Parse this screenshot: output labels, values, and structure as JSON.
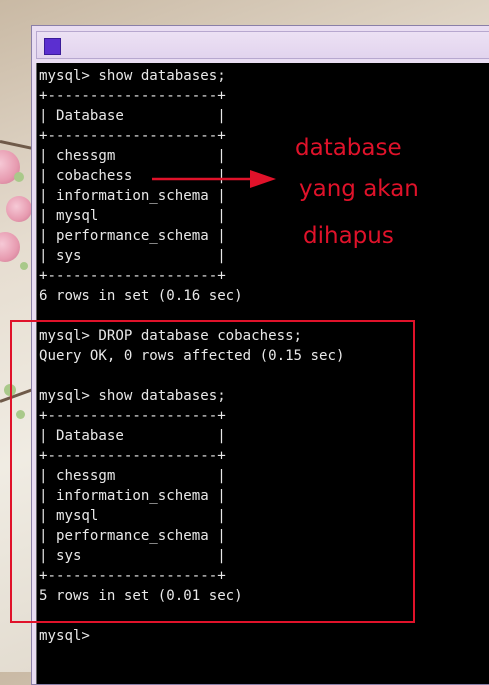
{
  "console": {
    "lines": [
      "mysql> show databases;",
      "+--------------------+",
      "| Database           |",
      "+--------------------+",
      "| chessgm            |",
      "| cobachess          |",
      "| information_schema |",
      "| mysql              |",
      "| performance_schema |",
      "| sys                |",
      "+--------------------+",
      "6 rows in set (0.16 sec)",
      "",
      "mysql> DROP database cobachess;",
      "Query OK, 0 rows affected (0.15 sec)",
      "",
      "mysql> show databases;",
      "+--------------------+",
      "| Database           |",
      "+--------------------+",
      "| chessgm            |",
      "| information_schema |",
      "| mysql              |",
      "| performance_schema |",
      "| sys                |",
      "+--------------------+",
      "5 rows in set (0.01 sec)",
      "",
      "mysql> "
    ]
  },
  "annotation": {
    "line1": "database",
    "line2": "yang akan",
    "line3": "dihapus",
    "color": "#e0122a"
  },
  "icons": {
    "app": "terminal-app-icon",
    "arrow": "right-arrow-icon"
  }
}
